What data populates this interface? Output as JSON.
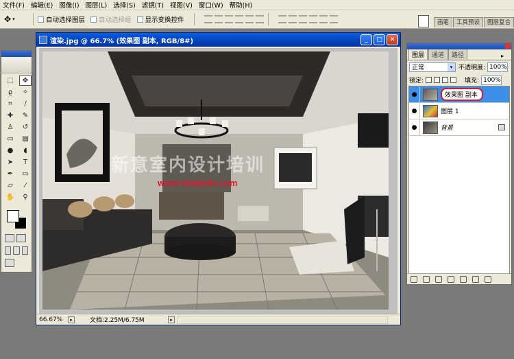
{
  "menu": [
    "文件(F)",
    "编辑(E)",
    "图像(I)",
    "图层(L)",
    "选择(S)",
    "滤镜(T)",
    "视图(V)",
    "窗口(W)",
    "帮助(H)"
  ],
  "options": {
    "auto_select_layer": "自动选择图层",
    "auto_select_group": "自动选择组",
    "show_transform": "显示变换控件"
  },
  "well_tabs": [
    "画笔",
    "工具预设",
    "图层复合"
  ],
  "document": {
    "title": "渲染.jpg @ 66.7% (效果图 副本, RGB/8#)",
    "zoom": "66.67%",
    "doc_info": "文档:2.25M/6.75M",
    "watermark_cn": "新意室内设计培训",
    "watermark_url": "www.shejiedu.com"
  },
  "layers_panel": {
    "tabs": [
      "图层",
      "通道",
      "路径"
    ],
    "blend_mode": "正常",
    "opacity_label": "不透明度:",
    "opacity_value": "100%",
    "lock_label": "锁定:",
    "fill_label": "填充:",
    "fill_value": "100%",
    "layers": [
      {
        "name": "效果图 副本",
        "selected": true
      },
      {
        "name": "图层 1",
        "selected": false
      },
      {
        "name": "背景",
        "selected": false,
        "locked": true
      }
    ]
  },
  "colors": {
    "title_bar": "#0a5ce6",
    "selected_layer": "#3d8ee8",
    "highlight_ring": "#e0162b",
    "watermark_url": "#e0162b"
  }
}
